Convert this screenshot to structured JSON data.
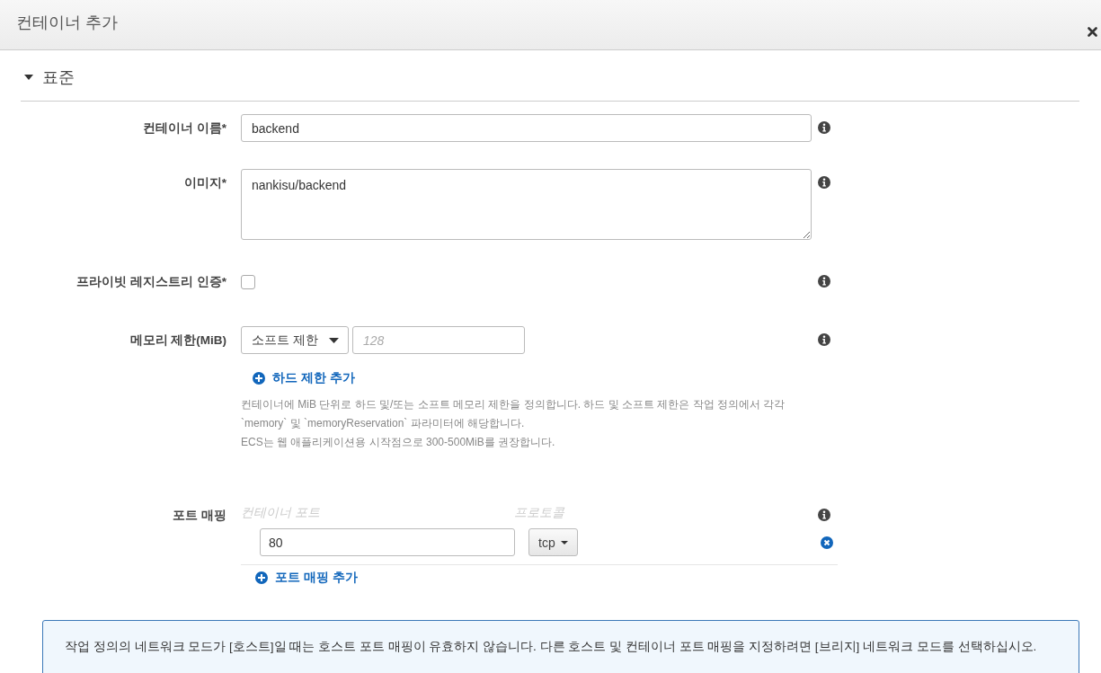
{
  "dialog": {
    "title": "컨테이너 추가"
  },
  "section": {
    "title": "표준",
    "expanded": true
  },
  "fields": [
    {
      "kind": "text",
      "label": "컨테이너 이름*",
      "value": "backend"
    },
    {
      "kind": "textarea",
      "label": "이미지*",
      "value": "nankisu/backend"
    },
    {
      "kind": "checkbox",
      "label": "프라이빗 레지스트리 인증*",
      "checked": false
    },
    {
      "kind": "memory",
      "label": "메모리 제한(MiB)",
      "select": "소프트 제한",
      "placeholder": "128",
      "link": "하드 제한 추가",
      "help": [
        "컨테이너에 MiB 단위로 하드 및/또는 소프트 메모리 제한을 정의합니다. 하드 및 소프트 제한은 작업 정의에서 각각",
        "`memory` 및 `memoryReservation` 파라미터에 해당합니다.",
        "ECS는 웹 애플리케이션용 시작점으로 300-500MiB를 권장합니다."
      ]
    },
    {
      "kind": "ports",
      "label": "포트 매핑",
      "columns": [
        "컨테이너 포트",
        "프로토콜"
      ],
      "rows": [
        {
          "port": "80",
          "protocol": "tcp"
        }
      ],
      "link": "포트 매핑 추가"
    }
  ],
  "alert": "작업 정의의 네트워크 모드가 [호스트]일 때는 호스트 포트 매핑이 유효하지 않습니다. 다른 호스트 및 컨테이너 포트 매핑을 지정하려면 [브리지] 네트워크 모드를 선택하십시오."
}
